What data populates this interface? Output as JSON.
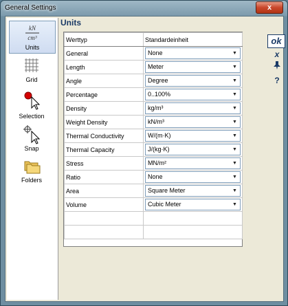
{
  "window": {
    "title": "General Settings",
    "close_glyph": "x"
  },
  "sidebar": {
    "items": [
      {
        "label": "Units",
        "icon": "units-icon",
        "active": true
      },
      {
        "label": "Grid",
        "icon": "grid-icon",
        "active": false
      },
      {
        "label": "Selection",
        "icon": "selection-icon",
        "active": false
      },
      {
        "label": "Snap",
        "icon": "snap-icon",
        "active": false
      },
      {
        "label": "Folders",
        "icon": "folders-icon",
        "active": false
      }
    ],
    "units_icon_text": {
      "top": "kN",
      "bottom": "cm³"
    }
  },
  "panel": {
    "title": "Units"
  },
  "table": {
    "headers": [
      "Werttyp",
      "Standardeinheit"
    ],
    "rows": [
      {
        "type": "General",
        "unit": "None"
      },
      {
        "type": "Length",
        "unit": "Meter"
      },
      {
        "type": "Angle",
        "unit": "Degree"
      },
      {
        "type": "Percentage",
        "unit": "0..100%"
      },
      {
        "type": "Density",
        "unit": "kg/m³"
      },
      {
        "type": "Weight Density",
        "unit": "kN/m³"
      },
      {
        "type": "Thermal Conductivity",
        "unit": "W/(m·K)"
      },
      {
        "type": "Thermal Capacity",
        "unit": "J/(kg·K)"
      },
      {
        "type": "Stress",
        "unit": "MN/m²"
      },
      {
        "type": "Ratio",
        "unit": "None"
      },
      {
        "type": "Area",
        "unit": "Square Meter"
      },
      {
        "type": "Volume",
        "unit": "Cubic Meter"
      }
    ]
  },
  "toolbar": {
    "ok_label": "ok",
    "cancel_glyph": "x",
    "help_glyph": "?"
  },
  "colors": {
    "accent": "#1a3a66",
    "close": "#c9472b",
    "dialog_bg": "#ece9d8"
  }
}
